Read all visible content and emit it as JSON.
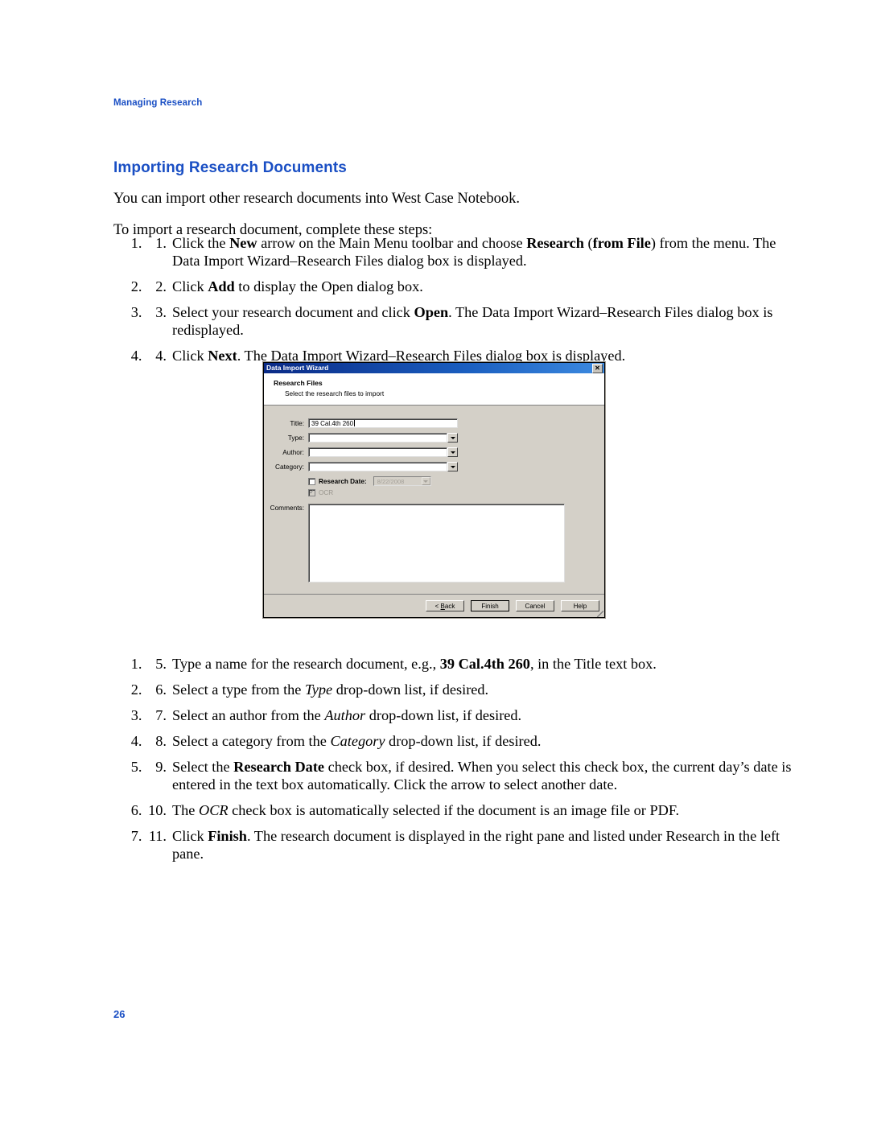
{
  "page": {
    "running_head": "Managing Research",
    "section_title": "Importing Research Documents",
    "page_number": "26"
  },
  "intro": {
    "paragraph1": "You can import other research documents into West Case Notebook.",
    "paragraph2": "To import a research document, complete these steps:"
  },
  "steps_top": [
    {
      "num": "1.",
      "parts": [
        {
          "text": "Click the ",
          "style": "normal"
        },
        {
          "text": "New",
          "style": "bold"
        },
        {
          "text": " arrow on the Main Menu toolbar and choose ",
          "style": "normal"
        },
        {
          "text": "Research",
          "style": "bold"
        },
        {
          "text": " (",
          "style": "normal"
        },
        {
          "text": "from File",
          "style": "bold"
        },
        {
          "text": ") from the menu. The Data Import Wizard–Research Files dialog box is displayed.",
          "style": "normal"
        }
      ]
    },
    {
      "num": "2.",
      "parts": [
        {
          "text": "Click ",
          "style": "normal"
        },
        {
          "text": "Add",
          "style": "bold"
        },
        {
          "text": " to display the Open dialog box.",
          "style": "normal"
        }
      ]
    },
    {
      "num": "3.",
      "parts": [
        {
          "text": "Select your research document and click ",
          "style": "normal"
        },
        {
          "text": "Open",
          "style": "bold"
        },
        {
          "text": ". The Data Import Wizard–Research Files dialog box is redisplayed.",
          "style": "normal"
        }
      ]
    },
    {
      "num": "4.",
      "parts": [
        {
          "text": "Click ",
          "style": "normal"
        },
        {
          "text": "Next",
          "style": "bold"
        },
        {
          "text": ". The Data Import Wizard–Research Files dialog box is displayed.",
          "style": "normal"
        }
      ]
    }
  ],
  "steps_bottom": [
    {
      "num": "5.",
      "parts": [
        {
          "text": "Type a name for the research document, e.g., ",
          "style": "normal"
        },
        {
          "text": "39 Cal.4th 260",
          "style": "bold"
        },
        {
          "text": ", in the Title text box.",
          "style": "normal"
        }
      ]
    },
    {
      "num": "6.",
      "parts": [
        {
          "text": "Select a type from the ",
          "style": "normal"
        },
        {
          "text": "Type",
          "style": "italic"
        },
        {
          "text": " drop-down list, if desired.",
          "style": "normal"
        }
      ]
    },
    {
      "num": "7.",
      "parts": [
        {
          "text": " Select an author from the ",
          "style": "normal"
        },
        {
          "text": "Author",
          "style": "italic"
        },
        {
          "text": " drop-down list, if desired.",
          "style": "normal"
        }
      ]
    },
    {
      "num": "8.",
      "parts": [
        {
          "text": "Select a category from the ",
          "style": "normal"
        },
        {
          "text": "Category",
          "style": "italic"
        },
        {
          "text": " drop-down list, if desired.",
          "style": "normal"
        }
      ]
    },
    {
      "num": "9.",
      "parts": [
        {
          "text": "Select the ",
          "style": "normal"
        },
        {
          "text": "Research Date",
          "style": "bold"
        },
        {
          "text": " check box, if desired. When you select this check box, the current day’s date is entered in the text box automatically. Click the arrow to select another date.",
          "style": "normal"
        }
      ]
    },
    {
      "num": "10.",
      "parts": [
        {
          "text": "The ",
          "style": "normal"
        },
        {
          "text": "OCR",
          "style": "italic"
        },
        {
          "text": " check box is automatically selected if the document is an image file or PDF.",
          "style": "normal"
        }
      ]
    },
    {
      "num": "11.",
      "parts": [
        {
          "text": "Click ",
          "style": "normal"
        },
        {
          "text": "Finish",
          "style": "bold"
        },
        {
          "text": ". The research document is displayed in the right pane and listed under Research in the left pane.",
          "style": "normal"
        }
      ]
    }
  ],
  "dialog": {
    "title": "Data Import Wizard",
    "close_label": "✕",
    "header_title": "Research Files",
    "header_subtitle": "Select the research files to import",
    "fields": {
      "title_label": "Title:",
      "title_value": "39 Cal.4th 260",
      "type_label": "Type:",
      "type_value": "",
      "author_label": "Author:",
      "author_value": "",
      "category_label": "Category:",
      "category_value": "",
      "research_date_label": "Research Date:",
      "research_date_value": "8/22/2008",
      "ocr_label": "OCR",
      "comments_label": "Comments:",
      "comments_value": ""
    },
    "buttons": {
      "back": "< Back",
      "back_accel": "B",
      "finish": "Finish",
      "cancel": "Cancel",
      "help": "Help"
    }
  },
  "colors": {
    "heading_blue": "#1a4fc4",
    "dialog_face": "#d4d0c8",
    "titlebar_blue": "#0a2a86"
  }
}
